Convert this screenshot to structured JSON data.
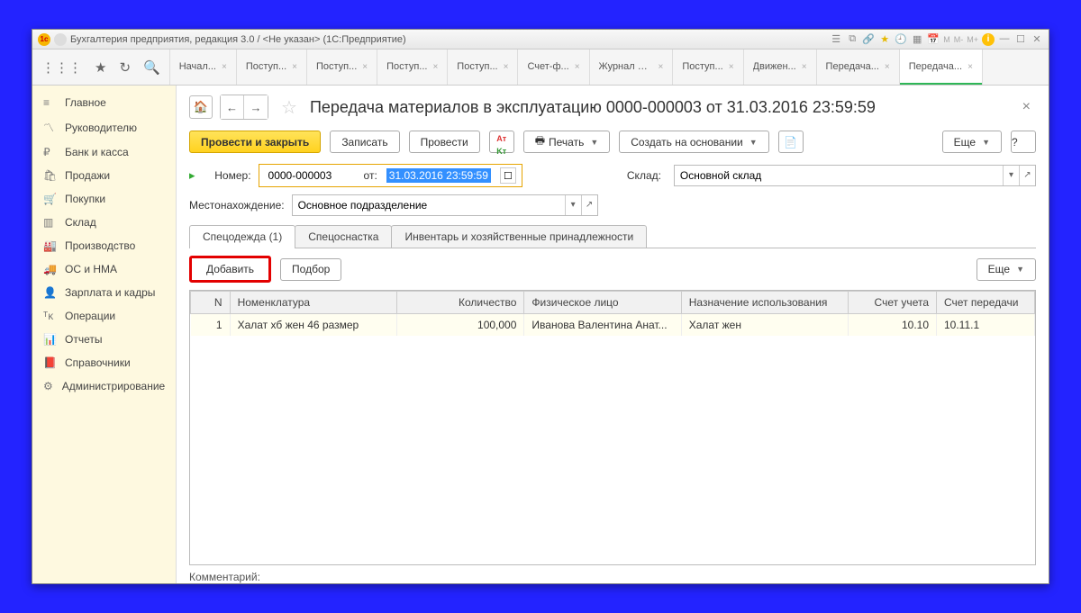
{
  "titlebar": {
    "text": "Бухгалтерия предприятия, редакция 3.0 / <Не указан> (1С:Предприятие)"
  },
  "top_tabs": [
    {
      "label": "Начал..."
    },
    {
      "label": "Поступ..."
    },
    {
      "label": "Поступ..."
    },
    {
      "label": "Поступ..."
    },
    {
      "label": "Поступ..."
    },
    {
      "label": "Счет-ф..."
    },
    {
      "label": "Журнал операций"
    },
    {
      "label": "Поступ..."
    },
    {
      "label": "Движен..."
    },
    {
      "label": "Передача..."
    },
    {
      "label": "Передача..."
    }
  ],
  "sidebar": [
    {
      "icon": "≡",
      "label": "Главное"
    },
    {
      "icon": "〽",
      "label": "Руководителю"
    },
    {
      "icon": "₽",
      "label": "Банк и касса"
    },
    {
      "icon": "🛍",
      "label": "Продажи"
    },
    {
      "icon": "🛒",
      "label": "Покупки"
    },
    {
      "icon": "▥",
      "label": "Склад"
    },
    {
      "icon": "🏭",
      "label": "Производство"
    },
    {
      "icon": "🚚",
      "label": "ОС и НМА"
    },
    {
      "icon": "👤",
      "label": "Зарплата и кадры"
    },
    {
      "icon": "ᵀᴋ",
      "label": "Операции"
    },
    {
      "icon": "📊",
      "label": "Отчеты"
    },
    {
      "icon": "📕",
      "label": "Справочники"
    },
    {
      "icon": "⚙",
      "label": "Администрирование"
    }
  ],
  "page": {
    "title": "Передача материалов в эксплуатацию 0000-000003 от 31.03.2016 23:59:59"
  },
  "actions": {
    "post_close": "Провести и закрыть",
    "write": "Записать",
    "post": "Провести",
    "print": "Печать",
    "create_based": "Создать на основании",
    "more": "Еще",
    "help": "?"
  },
  "form": {
    "number_label": "Номер:",
    "number": "0000-000003",
    "from_label": "от:",
    "date": "31.03.2016 23:59:59",
    "warehouse_label": "Склад:",
    "warehouse": "Основной склад",
    "location_label": "Местонахождение:",
    "location": "Основное подразделение"
  },
  "doc_tabs": [
    {
      "label": "Спецодежда (1)",
      "active": true
    },
    {
      "label": "Спецоснастка"
    },
    {
      "label": "Инвентарь и хозяйственные принадлежности"
    }
  ],
  "sub_actions": {
    "add": "Добавить",
    "pick": "Подбор",
    "more": "Еще"
  },
  "table": {
    "headers": {
      "n": "N",
      "nomen": "Номенклатура",
      "qty": "Количество",
      "person": "Физическое лицо",
      "purpose": "Назначение использования",
      "account": "Счет учета",
      "transfer_account": "Счет передачи"
    },
    "rows": [
      {
        "n": "1",
        "nomen": "Халат хб жен 46 размер",
        "qty": "100,000",
        "person": "Иванова Валентина Анат...",
        "purpose": "Халат жен",
        "account": "10.10",
        "transfer_account": "10.11.1"
      }
    ]
  },
  "comment_label": "Комментарий:"
}
